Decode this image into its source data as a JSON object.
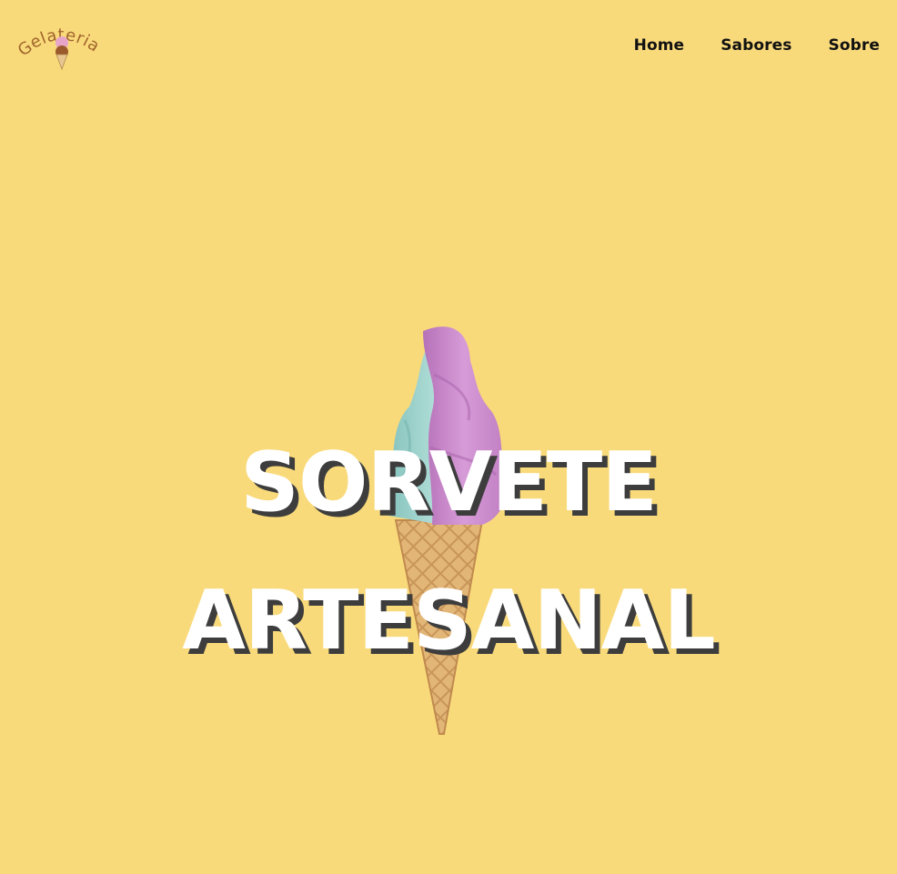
{
  "brand": {
    "name": "Gelateria"
  },
  "nav": {
    "items": [
      {
        "label": "Home"
      },
      {
        "label": "Sabores"
      },
      {
        "label": "Sobre"
      }
    ]
  },
  "hero": {
    "line1": "SORVETE",
    "line2": "ARTESANAL",
    "image_icon": "ice-cream-cone-icon"
  },
  "colors": {
    "background": "#f9da7b",
    "title": "#ffffff",
    "title_shadow": "#3d3d3d",
    "nav_text": "#111111",
    "logo": "#a0652c",
    "cream_pink": "#cf8fd0",
    "cream_teal": "#9fd3cc",
    "cone": "#e2b676"
  }
}
